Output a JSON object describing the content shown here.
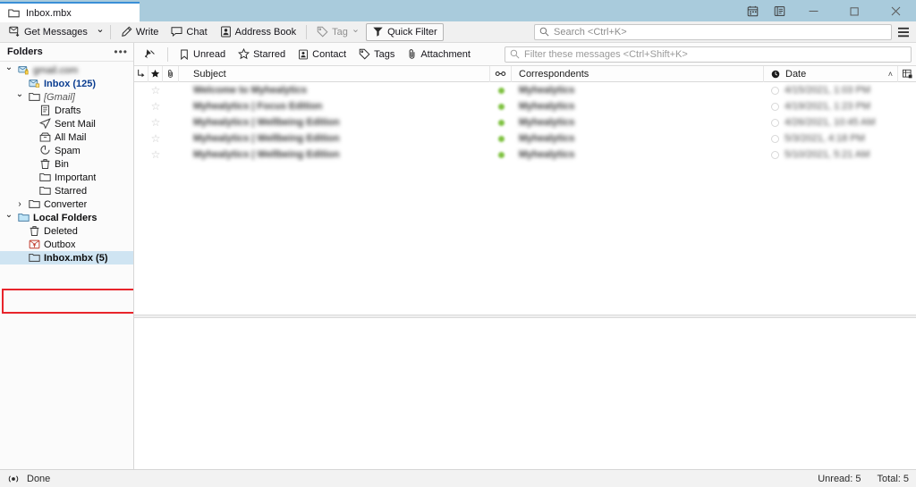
{
  "window": {
    "tab": {
      "label": "Inbox.mbx",
      "icon": "folder-icon"
    },
    "titlebar_icons": [
      {
        "name": "calendar-icon",
        "label": "Calendar"
      },
      {
        "name": "tasks-icon",
        "label": "Tasks"
      }
    ],
    "controls": [
      {
        "name": "minimize-button",
        "label": "Minimize"
      },
      {
        "name": "maximize-button",
        "label": "Maximize"
      },
      {
        "name": "close-button",
        "label": "Close"
      }
    ],
    "accent_color": "#3a8fd6",
    "titlebar_color": "#a9cbdc"
  },
  "toolbar": {
    "get_messages_label": "Get Messages",
    "get_messages_caret": "⌄",
    "write_label": "Write",
    "chat_label": "Chat",
    "address_book_label": "Address Book",
    "tag_label": "Tag",
    "tag_caret": "⌄",
    "quick_filter_label": "Quick Filter",
    "search_placeholder": "Search <Ctrl+K>",
    "search_value": "",
    "menu_label": "Application Menu"
  },
  "sidebar": {
    "header_title": "Folders",
    "more_label": "•••",
    "items": [
      {
        "label": "gmail.com",
        "blurred": true,
        "depth": 0,
        "twisty": "⌄",
        "icon": "account-icon",
        "style": "normal"
      },
      {
        "label": "Inbox (125)",
        "blurred": false,
        "depth": 1,
        "twisty": "",
        "icon": "inbox-icon",
        "style": "bold-blue"
      },
      {
        "label": "[Gmail]",
        "blurred": false,
        "depth": 1,
        "twisty": "⌄",
        "icon": "folder-icon",
        "style": "italic"
      },
      {
        "label": "Drafts",
        "blurred": false,
        "depth": 2,
        "twisty": "",
        "icon": "drafts-icon",
        "style": "normal"
      },
      {
        "label": "Sent Mail",
        "blurred": false,
        "depth": 2,
        "twisty": "",
        "icon": "sent-icon",
        "style": "normal"
      },
      {
        "label": "All Mail",
        "blurred": false,
        "depth": 2,
        "twisty": "",
        "icon": "archive-icon",
        "style": "normal"
      },
      {
        "label": "Spam",
        "blurred": false,
        "depth": 2,
        "twisty": "",
        "icon": "spam-icon",
        "style": "normal"
      },
      {
        "label": "Bin",
        "blurred": false,
        "depth": 2,
        "twisty": "",
        "icon": "trash-icon",
        "style": "normal"
      },
      {
        "label": "Important",
        "blurred": false,
        "depth": 2,
        "twisty": "",
        "icon": "folder-icon",
        "style": "normal"
      },
      {
        "label": "Starred",
        "blurred": false,
        "depth": 2,
        "twisty": "",
        "icon": "folder-icon",
        "style": "normal"
      },
      {
        "label": "Converter",
        "blurred": false,
        "depth": 1,
        "twisty": "›",
        "icon": "folder-icon",
        "style": "normal"
      },
      {
        "label": "Local Folders",
        "blurred": false,
        "depth": 0,
        "twisty": "⌄",
        "icon": "local-folders-icon",
        "style": "bold"
      },
      {
        "label": "Deleted",
        "blurred": false,
        "depth": 1,
        "twisty": "",
        "icon": "trash-icon",
        "style": "normal"
      },
      {
        "label": "Outbox",
        "blurred": false,
        "depth": 1,
        "twisty": "",
        "icon": "outbox-icon",
        "style": "normal"
      },
      {
        "label": "Inbox.mbx (5)",
        "blurred": false,
        "depth": 1,
        "twisty": "",
        "icon": "folder-icon",
        "style": "bold",
        "selected": true
      }
    ],
    "highlight": {
      "color": "#e8242b",
      "target_label": "Inbox.mbx (5)"
    }
  },
  "quick_filter_bar": {
    "pin_label": "Pin",
    "buttons": [
      {
        "label": "Unread",
        "icon": "unread-icon"
      },
      {
        "label": "Starred",
        "icon": "star-icon"
      },
      {
        "label": "Contact",
        "icon": "contact-icon"
      },
      {
        "label": "Tags",
        "icon": "tag-icon"
      },
      {
        "label": "Attachment",
        "icon": "attachment-icon"
      }
    ],
    "filter_placeholder": "Filter these messages <Ctrl+Shift+K>",
    "filter_value": ""
  },
  "message_list": {
    "columns": [
      {
        "key": "thread",
        "label": "",
        "icon": "thread-icon"
      },
      {
        "key": "star",
        "label": "",
        "icon": "star-icon"
      },
      {
        "key": "attach",
        "label": "",
        "icon": "attachment-icon"
      },
      {
        "key": "subject",
        "label": "Subject"
      },
      {
        "key": "unread",
        "label": "",
        "icon": "unread-dot-icon"
      },
      {
        "key": "correspondents",
        "label": "Correspondents"
      },
      {
        "key": "date",
        "label": "Date",
        "icon": "clock-icon",
        "sort": "˄"
      },
      {
        "key": "picker",
        "label": "",
        "icon": "column-picker-icon"
      }
    ],
    "rows": [
      {
        "subject": "Welcome to Myhealytics",
        "correspondent": "Myhealytics",
        "date": "4/15/2021, 1:03 PM",
        "unread": true,
        "starred": false,
        "blurred": true
      },
      {
        "subject": "Myhealytics | Focus Edition",
        "correspondent": "Myhealytics",
        "date": "4/19/2021, 1:23 PM",
        "unread": true,
        "starred": false,
        "blurred": true
      },
      {
        "subject": "Myhealytics | Wellbeing Edition",
        "correspondent": "Myhealytics",
        "date": "4/26/2021, 10:45 AM",
        "unread": true,
        "starred": false,
        "blurred": true
      },
      {
        "subject": "Myhealytics | Wellbeing Edition",
        "correspondent": "Myhealytics",
        "date": "5/3/2021, 4:18 PM",
        "unread": true,
        "starred": false,
        "blurred": true
      },
      {
        "subject": "Myhealytics | Wellbeing Edition",
        "correspondent": "Myhealytics",
        "date": "5/10/2021, 5:21 AM",
        "unread": true,
        "starred": false,
        "blurred": true
      }
    ]
  },
  "statusbar": {
    "network_icon": "network-activity-icon",
    "message": "Done",
    "unread_label": "Unread: 5",
    "total_label": "Total: 5"
  }
}
